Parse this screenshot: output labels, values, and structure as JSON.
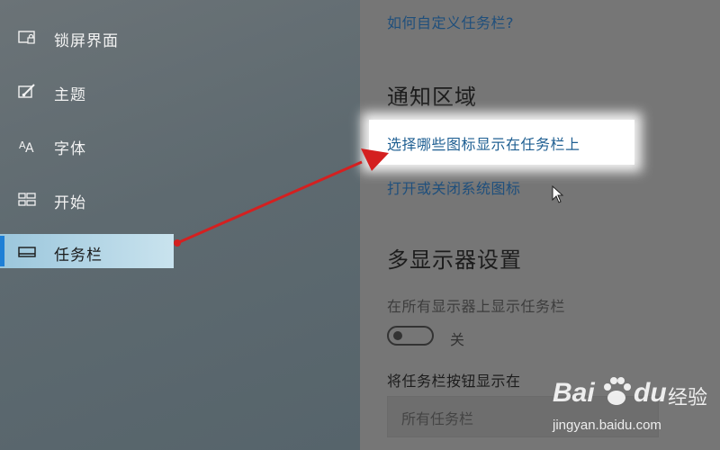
{
  "sidebar": {
    "items": [
      {
        "label": "锁屏界面",
        "icon": "lockscreen-icon"
      },
      {
        "label": "主题",
        "icon": "theme-brush-icon"
      },
      {
        "label": "字体",
        "icon": "font-icon"
      },
      {
        "label": "开始",
        "icon": "start-icon"
      },
      {
        "label": "任务栏",
        "icon": "taskbar-icon",
        "selected": true
      }
    ]
  },
  "main": {
    "top_link": "如何自定义任务栏?",
    "notification_section": {
      "heading": "通知区域",
      "link_choose_icons": "选择哪些图标显示在任务栏上",
      "link_system_icons": "打开或关闭系统图标"
    },
    "multi_display_section": {
      "heading": "多显示器设置",
      "show_on_all_label": "在所有显示器上显示任务栏",
      "toggle_state": "关",
      "buttons_label": "将任务栏按钮显示在",
      "buttons_dropdown_value": "所有任务栏"
    }
  },
  "annotation": {
    "arrow_color": "#d42020"
  },
  "watermark": {
    "brand_left": "Bai",
    "brand_right": "du",
    "brand_cn": "经验",
    "url": "jingyan.baidu.com"
  },
  "colors": {
    "accent": "#1e7fd6",
    "link": "#1f4f7c",
    "selected_bg": "#b6d8e8"
  }
}
